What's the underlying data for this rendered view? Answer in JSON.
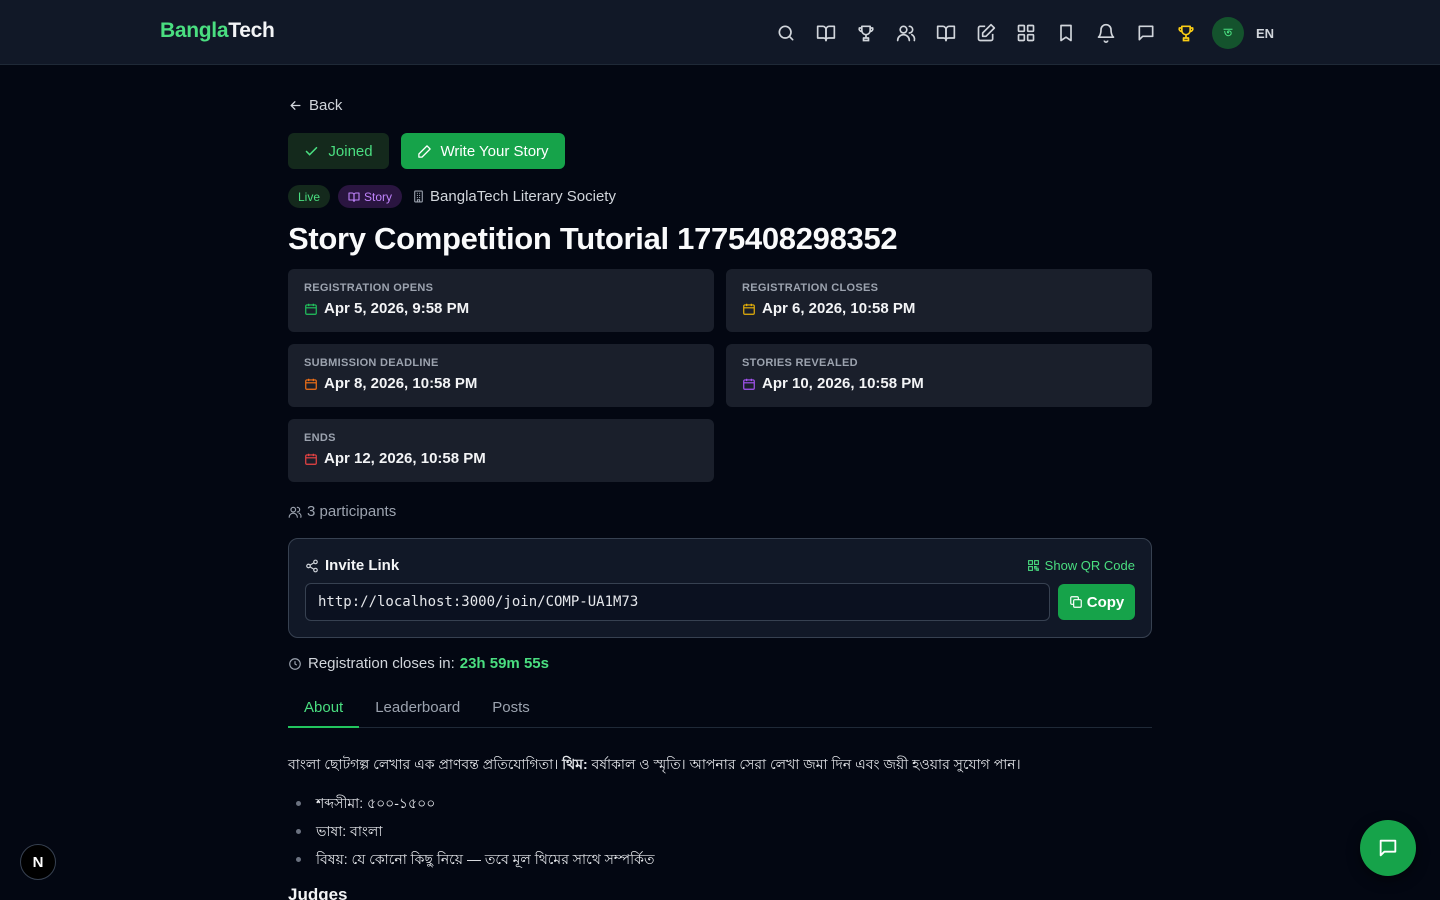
{
  "brand": {
    "part1": "Bangla",
    "part2": "Tech"
  },
  "nav": {
    "icons": [
      "search-icon",
      "book-open-icon",
      "trophy-icon",
      "users-icon",
      "book-open-icon",
      "pencil-square-icon",
      "grid-icon",
      "bookmark-icon",
      "bell-icon",
      "message-icon",
      "trophy-icon"
    ],
    "avatar_initial": "ত",
    "lang": "EN"
  },
  "back_label": "Back",
  "joined_label": "Joined",
  "write_label": "Write Your Story",
  "badges": {
    "live": "Live",
    "type": "Story"
  },
  "organizer": "BanglaTech Literary Society",
  "title": "Story Competition Tutorial 1775408298352",
  "dates": [
    {
      "label": "REGISTRATION OPENS",
      "value": "Apr 5, 2026, 9:58 PM",
      "color": "#22c55e"
    },
    {
      "label": "REGISTRATION CLOSES",
      "value": "Apr 6, 2026, 10:58 PM",
      "color": "#eab308"
    },
    {
      "label": "SUBMISSION DEADLINE",
      "value": "Apr 8, 2026, 10:58 PM",
      "color": "#f97316"
    },
    {
      "label": "STORIES REVEALED",
      "value": "Apr 10, 2026, 10:58 PM",
      "color": "#a855f7"
    },
    {
      "label": "ENDS",
      "value": "Apr 12, 2026, 10:58 PM",
      "color": "#ef4444"
    }
  ],
  "participants": "3 participants",
  "invite": {
    "heading": "Invite Link",
    "qr_label": "Show QR Code",
    "url": "http://localhost:3000/join/COMP-UA1M73",
    "copy_label": "Copy"
  },
  "countdown": {
    "label": "Registration closes in:",
    "value": "23h 59m 55s"
  },
  "tabs": [
    "About",
    "Leaderboard",
    "Posts"
  ],
  "about": {
    "intro_before": "বাংলা ছোটগল্প লেখার এক প্রাণবন্ত প্রতিযোগিতা। ",
    "intro_bold": "থিম:",
    "intro_after": " বর্ষাকাল ও স্মৃতি। আপনার সেরা লেখা জমা দিন এবং জয়ী হওয়ার সুযোগ পান।",
    "bullets": [
      "শব্দসীমা: ৫০০-১৫০০",
      "ভাষা: বাংলা",
      "বিষয়: যে কোনো কিছু নিয়ে — তবে মূল থিমের সাথে সম্পর্কিত"
    ],
    "judges_heading": "Judges"
  },
  "next_badge": "N"
}
